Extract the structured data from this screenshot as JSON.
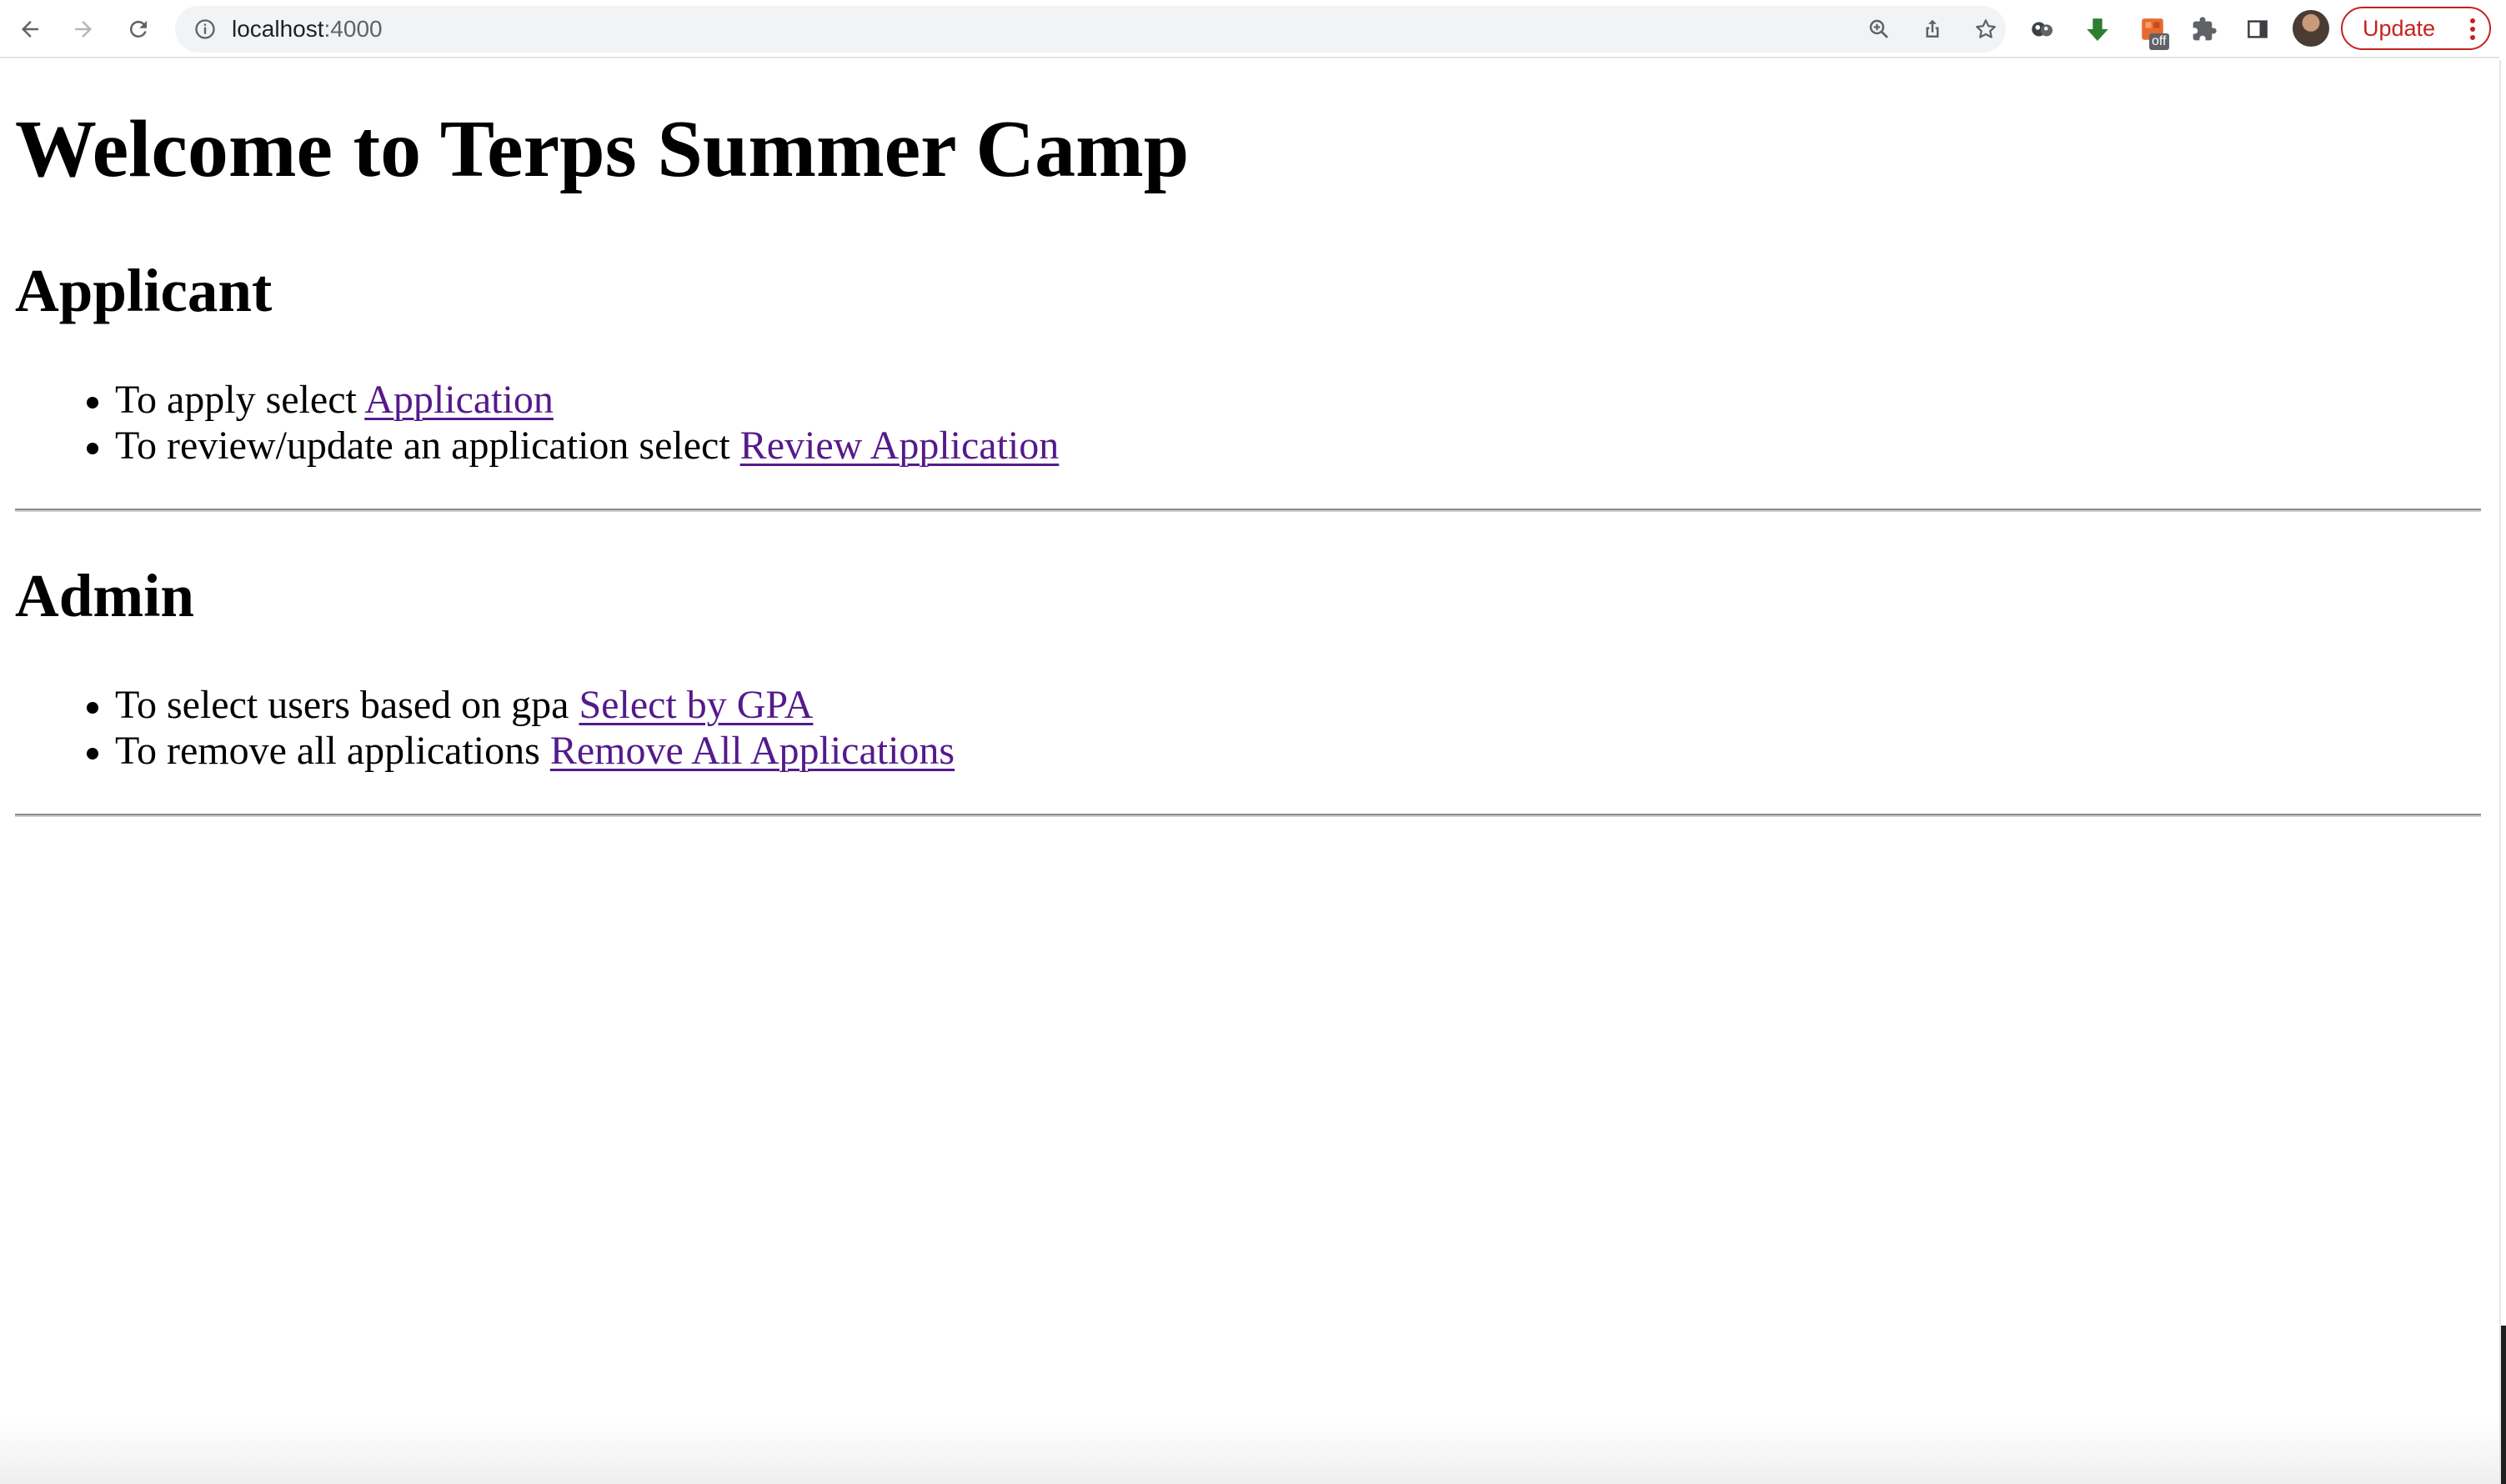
{
  "browser": {
    "url_host": "localhost",
    "url_port": ":4000",
    "update_label": "Update",
    "extension_badge": "off",
    "icons": {
      "back": "arrow-left-icon",
      "forward": "arrow-right-icon",
      "reload": "reload-icon",
      "site_info": "info-icon",
      "zoom": "zoom-icon",
      "share": "share-icon",
      "bookmark": "star-icon",
      "extension_1": "extension-eyes-icon",
      "extension_2": "green-download-arrow-icon",
      "extension_3": "extension-off-icon",
      "extensions": "puzzle-icon",
      "side_panel": "side-panel-icon",
      "menu": "vertical-dots-icon"
    },
    "colors": {
      "update_accent": "#c5221f",
      "download_green": "#2e7d32"
    }
  },
  "page": {
    "title": "Welcome to Terps Summer Camp",
    "link_color": "#551a8b",
    "sections": {
      "applicant": {
        "heading": "Applicant",
        "items": [
          {
            "text": "To apply select ",
            "link": "Application"
          },
          {
            "text": "To review/update an application select ",
            "link": "Review Application"
          }
        ]
      },
      "admin": {
        "heading": "Admin",
        "items": [
          {
            "text": "To select users based on gpa ",
            "link": "Select by GPA"
          },
          {
            "text": "To remove all applications ",
            "link": "Remove All Applications"
          }
        ]
      }
    }
  }
}
